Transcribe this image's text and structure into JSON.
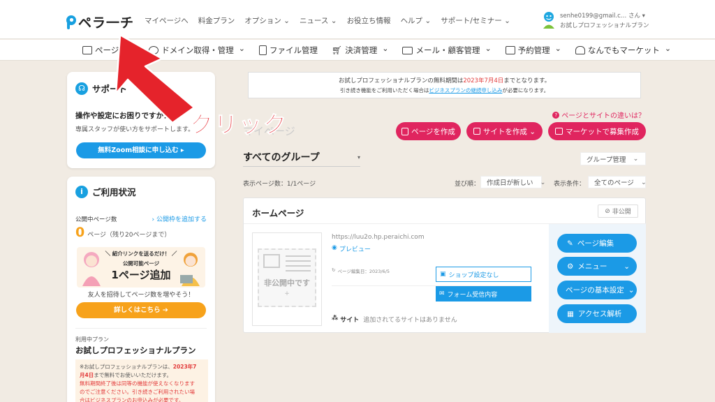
{
  "brand": {
    "name": "ペラ一チ",
    "accent": "#18a0e0",
    "pink": "#e0255f"
  },
  "topnav": [
    "マイページへ",
    "料金プラン",
    "オプション ⌄",
    "ニュース ⌄",
    "お役立ち情報",
    "ヘルプ ⌄",
    "サポート/セミナー ⌄"
  ],
  "user": {
    "email": "senhe0199@gmail.c… さん ▾",
    "plan": "お試しプロフェッショナルプラン"
  },
  "subnav": [
    {
      "label": "ページ管理",
      "icon": "page-icon"
    },
    {
      "label": "ドメイン取得・管理",
      "icon": "globe-icon"
    },
    {
      "label": "ファイル管理",
      "icon": "file-icon"
    },
    {
      "label": "決済管理",
      "icon": "cart-icon"
    },
    {
      "label": "メール・顧客管理",
      "icon": "mail-icon"
    },
    {
      "label": "予約管理",
      "icon": "calendar-icon"
    },
    {
      "label": "なんでもマーケット",
      "icon": "market-icon"
    }
  ],
  "support": {
    "title": "サポート",
    "question": "操作や設定にお困りですか？",
    "desc": "専属スタッフが使い方をサポートします。",
    "button": "無料Zoom相談に申し込む ▸"
  },
  "usage": {
    "title": "ご利用状況",
    "pages_label": "公開中ページ数",
    "add_link": "› 公開枠を追加する",
    "count": "0",
    "count_unit": "ページ（残り20ページまで）",
    "promo_top": "＼ 紹介リンクを送るだけ！ ／",
    "promo_sub": "公開可能ページ",
    "promo_main": "1ページ追加",
    "invite": "友人を招待してページ数を増やそう！",
    "detail_button": "詳しくはこちら ➔",
    "plan_label": "利用中プラン",
    "plan_name": "お試しプロフェッショナルプラン",
    "notice1a": "※お試しプロフェッショナルプランは、",
    "notice1b": "2023年7",
    "notice1c": "月4日",
    "notice1d": "まで無料でお使いいただけます。",
    "notice2": "無料期間終了後は同等の機能が使えなくなります",
    "notice3": "のでご注意ください。引き続きご利用されたい場",
    "notice4": "合はビジネスプランのお申込みが必要です。"
  },
  "banner": {
    "line1a": "お試しプロフェッショナルプランの無料期間は",
    "line1b": "2023年7月4日",
    "line1c": "までとなります。",
    "line2a": "引き続き機能をご利用いただく場合は",
    "line2b": "ビジネスプランの継続申し込み",
    "line2c": "が必要になります。"
  },
  "main": {
    "diff_link": "ページとサイトの違いは？",
    "title_faint": "マイページ",
    "btn_create_page": "ページを作成",
    "btn_create_site": "サイトを作成 ⌄",
    "btn_market": "マーケットで募集作成",
    "group_title": "すべてのグループ",
    "group_manage": "グループ管理",
    "display_count": "表示ページ数：1/1ページ",
    "sort_label": "並び順：",
    "sort_value": "作成日が新しい",
    "filter_label": "表示条件：",
    "filter_value": "全てのページ"
  },
  "page_card": {
    "title": "ホームページ",
    "private_badge": "非公開",
    "thumb_text": "非公開中です",
    "url": "https://luu2o.hp.peraichi.com",
    "preview": "プレビュー",
    "edited": "ページ編集日：2023/6/5",
    "shop": "ショップ設定なし",
    "form": "フォーム受信内容",
    "site_label": "サイト",
    "site_none": "追加されてるサイトはありません",
    "actions": [
      "ページ編集",
      "メニュー",
      "ページの基本設定",
      "アクセス解析"
    ]
  },
  "annotation": {
    "text": "クリック",
    "color": "#e5232b"
  }
}
